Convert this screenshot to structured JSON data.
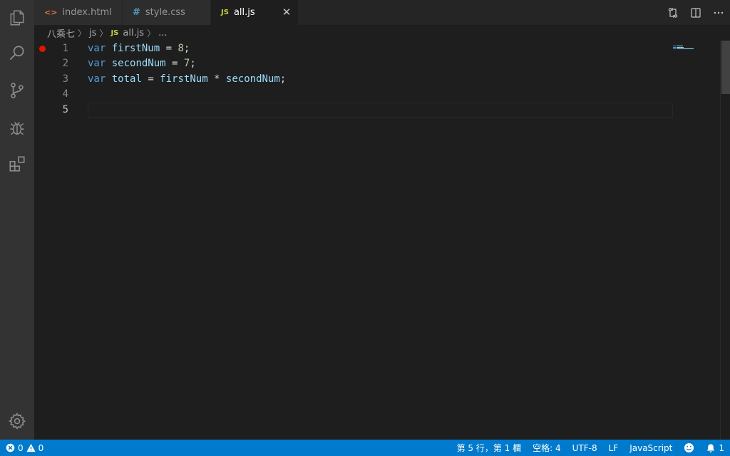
{
  "tabs": [
    {
      "icon": "<>",
      "label": "index.html",
      "icon_color": "#e37933"
    },
    {
      "icon": "#",
      "label": "style.css",
      "icon_color": "#519aba"
    },
    {
      "icon": "JS",
      "label": "all.js",
      "icon_color": "#cbcb41",
      "active": true
    }
  ],
  "breadcrumb": {
    "folder": "八乘七",
    "sub": "js",
    "file_icon": "JS",
    "file": "all.js",
    "more": "..."
  },
  "editor": {
    "lines": [
      {
        "n": "1",
        "breakpoint": true
      },
      {
        "n": "2"
      },
      {
        "n": "3"
      },
      {
        "n": "4"
      },
      {
        "n": "5",
        "current": true
      }
    ],
    "code": {
      "l1": {
        "kw": "var",
        "id": "firstNum",
        "op": " = ",
        "num": "8",
        "end": ";"
      },
      "l2": {
        "kw": "var",
        "id": "secondNum",
        "op": " = ",
        "num": "7",
        "end": ";"
      },
      "l3": {
        "kw": "var",
        "id": "total",
        "op1": " = ",
        "a": "firstNum",
        "op2": " * ",
        "b": "secondNum",
        "end": ";"
      }
    }
  },
  "statusbar": {
    "errors": "0",
    "warnings": "0",
    "position": "第 5 行，第 1 欄",
    "spaces": "空格: 4",
    "encoding": "UTF-8",
    "eol": "LF",
    "language": "JavaScript",
    "notifications": "1"
  },
  "colors": {
    "accent": "#007acc",
    "breakpoint": "#e51400",
    "activity_bar": "#333333",
    "editor_bg": "#1e1e1e"
  }
}
